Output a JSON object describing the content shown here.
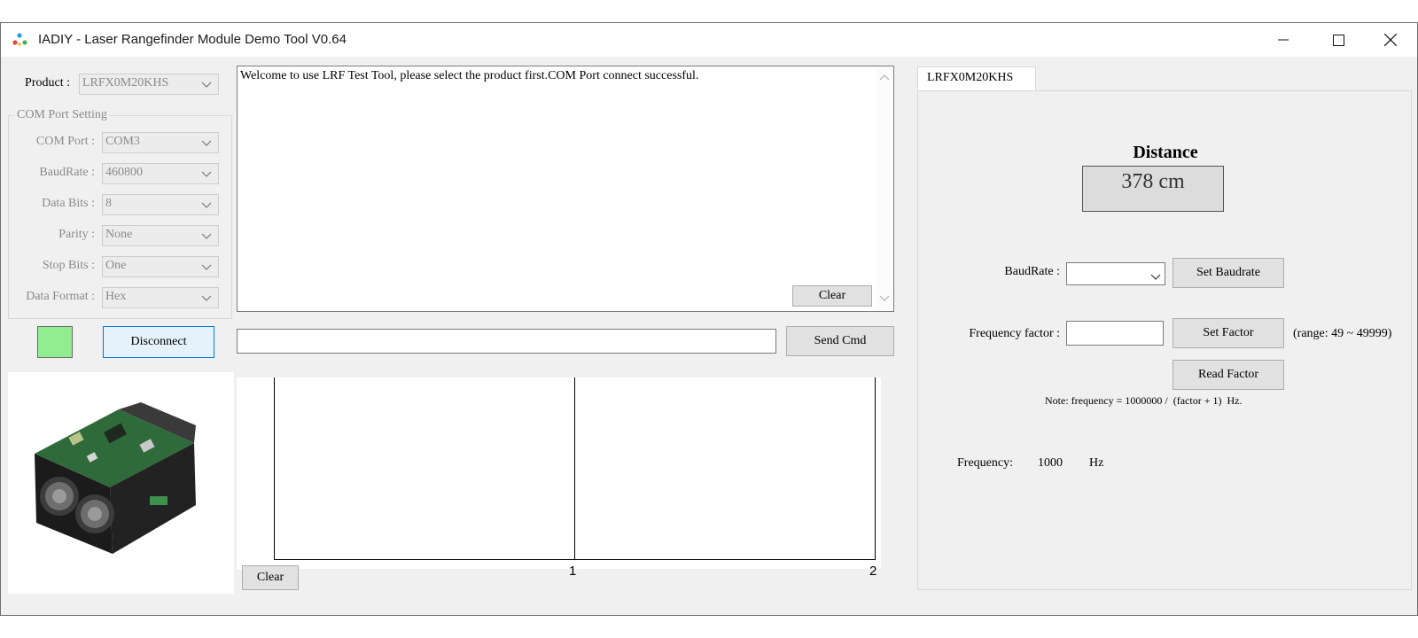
{
  "window": {
    "title": "IADIY - Laser Rangefinder Module Demo Tool V0.64"
  },
  "left_panel": {
    "product_label": "Product :",
    "product_value": "LRFX0M20KHS",
    "com_group_title": "COM Port Setting",
    "settings": [
      {
        "label": "COM Port :",
        "value": "COM3"
      },
      {
        "label": "BaudRate :",
        "value": "460800"
      },
      {
        "label": "Data Bits :",
        "value": "8"
      },
      {
        "label": "Parity :",
        "value": "None"
      },
      {
        "label": "Stop Bits :",
        "value": "One"
      },
      {
        "label": "Data Format :",
        "value": "Hex"
      }
    ],
    "connection_status_color": "#90ee90",
    "disconnect_label": "Disconnect"
  },
  "log": {
    "text": "Welcome to use LRF Test Tool, please select the product first.COM Port connect successful.",
    "clear_label": "Clear"
  },
  "command": {
    "value": "",
    "send_label": "Send Cmd"
  },
  "graph": {
    "x_ticks": [
      "1",
      "2"
    ],
    "clear_label": "Clear"
  },
  "right_panel": {
    "tab_label": "LRFX0M20KHS",
    "distance_title": "Distance",
    "distance_value": "378 cm",
    "baudrate_label": "BaudRate :",
    "baudrate_value": "",
    "set_baudrate_label": "Set Baudrate",
    "freq_factor_label": "Frequency factor :",
    "freq_factor_value": "",
    "set_factor_label": "Set Factor",
    "range_note": "(range: 49 ~ 49999)",
    "read_factor_label": "Read Factor",
    "formula_note": "Note: frequency = 1000000 /  (factor + 1)  Hz.",
    "frequency_label": "Frequency:",
    "frequency_value": "1000",
    "frequency_unit": "Hz"
  }
}
